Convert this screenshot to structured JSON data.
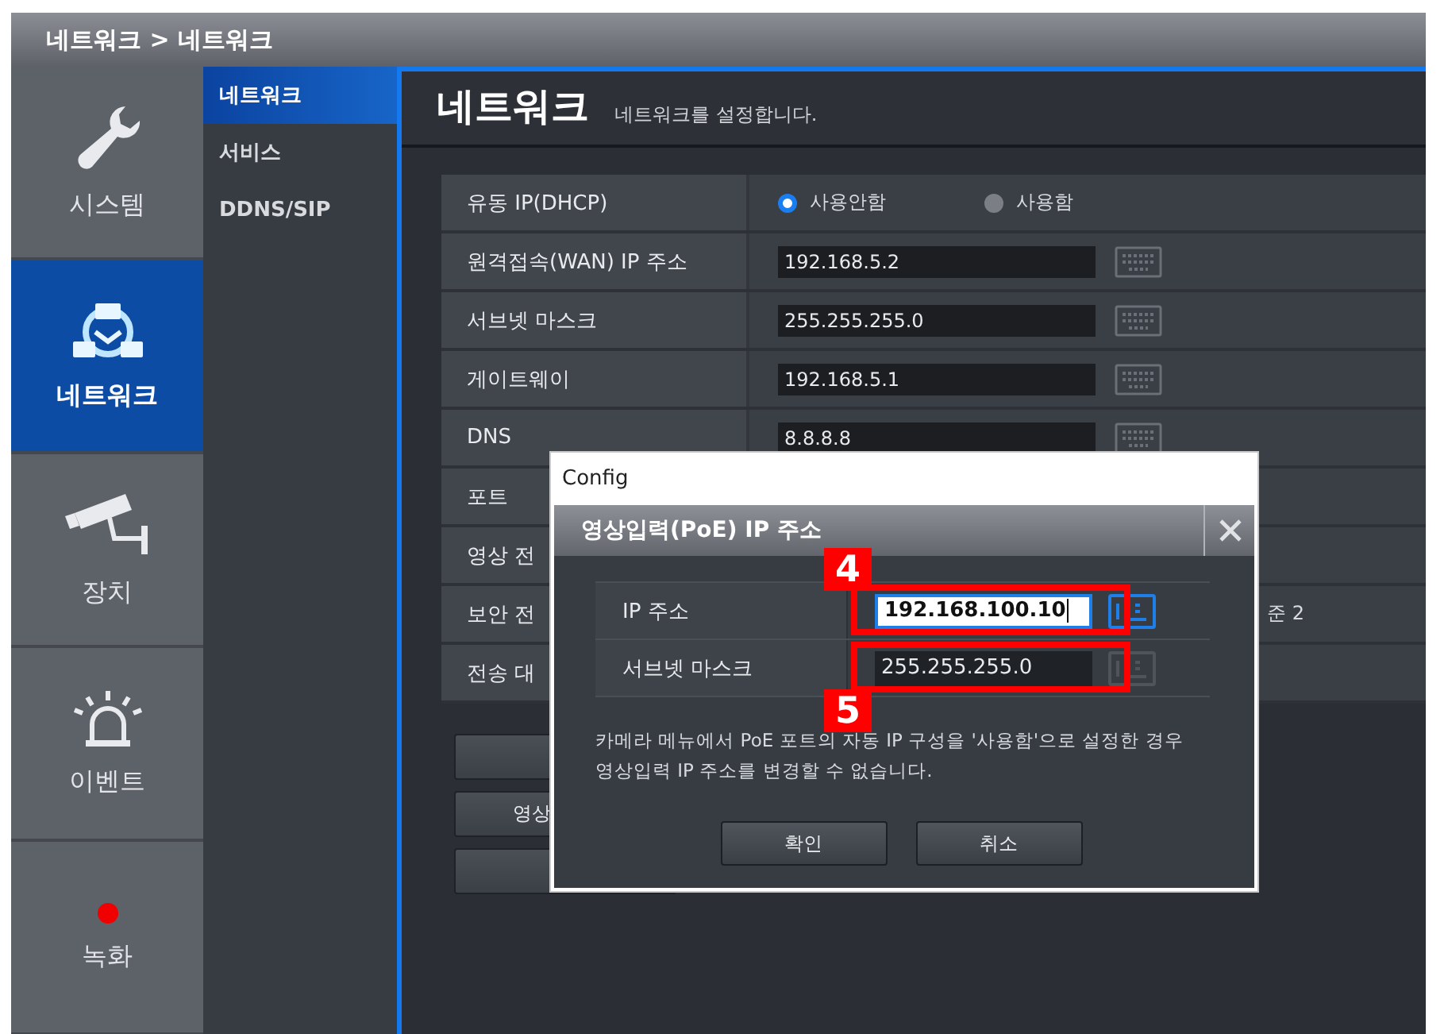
{
  "breadcrumb": "네트워크 > 네트워크",
  "nav": [
    {
      "label": "시스템",
      "kind": "wrench",
      "selected": false
    },
    {
      "label": "네트워크",
      "kind": "network",
      "selected": true
    },
    {
      "label": "장치",
      "kind": "camera",
      "selected": false
    },
    {
      "label": "이벤트",
      "kind": "siren",
      "selected": false
    },
    {
      "label": "녹화",
      "kind": "record",
      "selected": false
    }
  ],
  "submenu": [
    {
      "label": "네트워크",
      "selected": true
    },
    {
      "label": "서비스",
      "selected": false
    },
    {
      "label": "DDNS/SIP",
      "selected": false
    }
  ],
  "page": {
    "title": "네트워크",
    "subtitle": "네트워크를 설정합니다."
  },
  "settings": [
    {
      "label": "유동 IP(DHCP)",
      "kind": "radio",
      "options": [
        {
          "label": "사용안함",
          "selected": true
        },
        {
          "label": "사용함",
          "selected": false
        }
      ]
    },
    {
      "label": "원격접속(WAN) IP 주소",
      "kind": "field",
      "value": "192.168.5.2"
    },
    {
      "label": "서브넷 마스크",
      "kind": "field",
      "value": "255.255.255.0"
    },
    {
      "label": "게이트웨이",
      "kind": "field",
      "value": "192.168.5.1"
    },
    {
      "label": "DNS",
      "kind": "field",
      "value": "8.8.8.8"
    },
    {
      "label": "포트",
      "kind": "covered"
    },
    {
      "label": "영상 전",
      "kind": "covered"
    },
    {
      "label": "보안 전",
      "kind": "text",
      "value": "준 2"
    },
    {
      "label": "전송 대",
      "kind": "covered"
    }
  ],
  "side_buttons": [
    {
      "kind": "blank"
    },
    {
      "kind": "text",
      "label": "영상"
    },
    {
      "kind": "blank"
    }
  ],
  "dialog": {
    "window_title": "Config",
    "title": "영상입력(PoE) IP 주소",
    "fields": [
      {
        "label": "IP 주소",
        "value": "192.168.100.10",
        "focused": true,
        "callout": {
          "label": "4",
          "above": true
        }
      },
      {
        "label": "서브넷 마스크",
        "value": "255.255.255.0",
        "focused": false,
        "callout": {
          "label": "5",
          "above": false
        }
      }
    ],
    "note_lines": [
      "카메라 메뉴에서 PoE 포트의 자동 IP 구성을 '사용함'으로 설정한 경우",
      "영상입력 IP 주소를 변경할 수 없습니다."
    ],
    "buttons": [
      "확인",
      "취소"
    ]
  }
}
